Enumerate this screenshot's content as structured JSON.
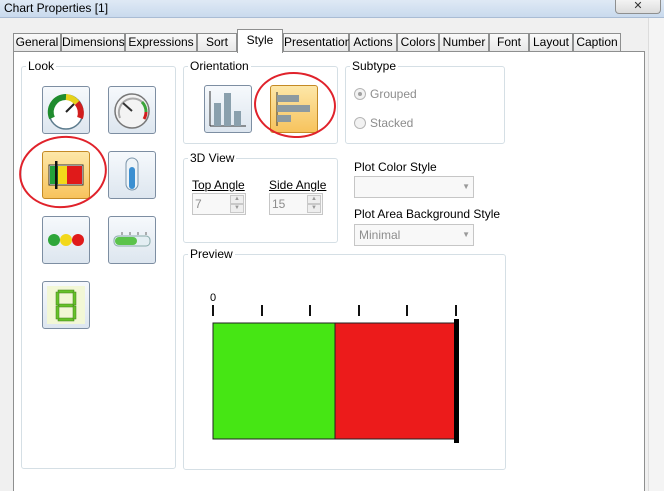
{
  "window": {
    "title": "Chart Properties [1]",
    "close_glyph": "✕"
  },
  "tabs": [
    {
      "label": "General"
    },
    {
      "label": "Dimensions"
    },
    {
      "label": "Expressions"
    },
    {
      "label": "Sort"
    },
    {
      "label": "Style",
      "active": true
    },
    {
      "label": "Presentation"
    },
    {
      "label": "Actions"
    },
    {
      "label": "Colors"
    },
    {
      "label": "Number"
    },
    {
      "label": "Font"
    },
    {
      "label": "Layout"
    },
    {
      "label": "Caption"
    }
  ],
  "look": {
    "legend": "Look",
    "icons": [
      "circular-gauge-icon",
      "speedometer-gauge-icon",
      "linear-gauge-icon",
      "thermometer-gauge-icon",
      "traffic-light-gauge-icon",
      "led-gauge-icon",
      "digital-gauge-icon"
    ],
    "selected_icon": "linear-gauge-icon"
  },
  "orientation": {
    "legend": "Orientation",
    "icons": [
      "vertical-bars-icon",
      "horizontal-bars-icon"
    ],
    "selected_icon": "horizontal-bars-icon"
  },
  "subtype": {
    "legend": "Subtype",
    "grouped": "Grouped",
    "stacked": "Stacked",
    "selected": "Grouped"
  },
  "view3d": {
    "legend": "3D View",
    "top_angle_label": "Top Angle",
    "top_angle_value": "7",
    "side_angle_label": "Side Angle",
    "side_angle_value": "15"
  },
  "plot_color_style": {
    "label": "Plot Color Style",
    "value": ""
  },
  "plot_area_bg_style": {
    "label": "Plot Area Background Style",
    "value": "Minimal"
  },
  "preview": {
    "legend": "Preview",
    "zero_label": "0"
  },
  "colors": {
    "gauge_green": "#46e614",
    "gauge_red": "#ec1b1b",
    "highlight_circle": "#e0222b",
    "selected_button": "#f7c35d"
  }
}
